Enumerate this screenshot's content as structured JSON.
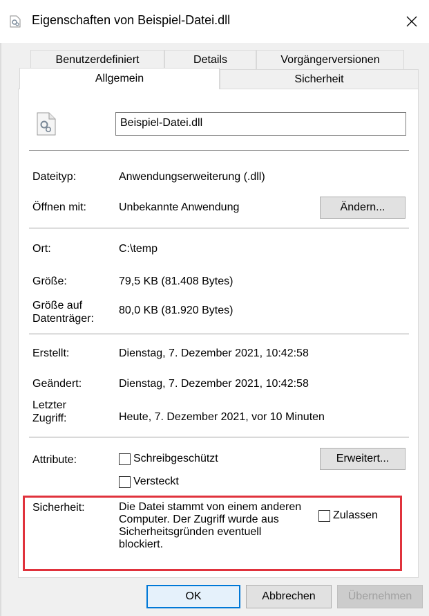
{
  "window": {
    "title": "Eigenschaften von Beispiel-Datei.dll",
    "close_glyph": "✕"
  },
  "tabs": {
    "row1": [
      "Benutzerdefiniert",
      "Details",
      "Vorgängerversionen"
    ],
    "row2": [
      "Allgemein",
      "Sicherheit"
    ],
    "active": "Allgemein"
  },
  "general": {
    "file_name": "Beispiel-Datei.dll",
    "file_icon": "dll-gear-file-icon",
    "filetype_label": "Dateityp:",
    "filetype_value": "Anwendungserweiterung (.dll)",
    "openwith_label": "Öffnen mit:",
    "openwith_value": "Unbekannte Anwendung",
    "change_button": "Ändern...",
    "location_label": "Ort:",
    "location_value": "C:\\temp",
    "size_label": "Größe:",
    "size_value": "79,5 KB (81.408 Bytes)",
    "size_disk_label": "Größe auf Datenträger:",
    "size_disk_value": "80,0 KB (81.920 Bytes)",
    "created_label": "Erstellt:",
    "created_value": "Dienstag, 7. Dezember 2021, 10:42:58",
    "modified_label": "Geändert:",
    "modified_value": "Dienstag, 7. Dezember 2021, 10:42:58",
    "accessed_label": "Letzter Zugriff:",
    "accessed_value": "Heute, 7. Dezember 2021, vor 10 Minuten",
    "attributes_label": "Attribute:",
    "readonly_label": "Schreibgeschützt",
    "readonly_checked": false,
    "hidden_label": "Versteckt",
    "hidden_checked": false,
    "advanced_button": "Erweitert...",
    "security_label": "Sicherheit:",
    "security_text": "Die Datei stammt von einem anderen Computer. Der Zugriff wurde aus Sicherheitsgründen eventuell blockiert.",
    "allow_label": "Zulassen",
    "allow_checked": false
  },
  "buttons": {
    "ok": "OK",
    "cancel": "Abbrechen",
    "apply": "Übernehmen"
  },
  "colors": {
    "highlight_border": "#e0323c",
    "ok_border": "#0078d7",
    "disabled_text": "#a0a0a0"
  }
}
